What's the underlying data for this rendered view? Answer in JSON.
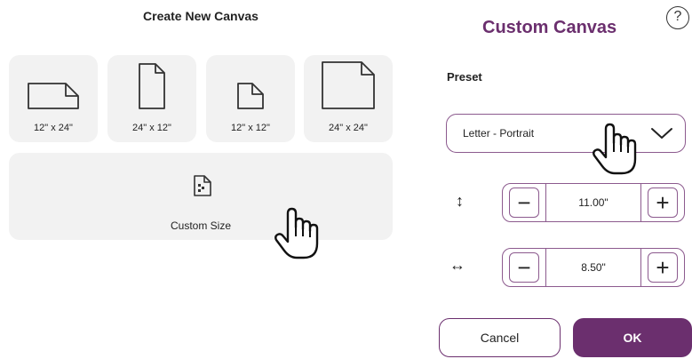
{
  "left_panel": {
    "title": "Create New Canvas",
    "tiles": [
      {
        "label": "12\" x 24\"",
        "icon": "landscape-page-icon"
      },
      {
        "label": "24\" x 12\"",
        "icon": "portrait-page-icon"
      },
      {
        "label": "12\" x 12\"",
        "icon": "small-square-page-icon"
      },
      {
        "label": "24\" x 24\"",
        "icon": "large-square-page-icon"
      }
    ],
    "custom_tile": {
      "label": "Custom Size",
      "icon": "custom-size-icon"
    }
  },
  "right_panel": {
    "title": "Custom Canvas",
    "help_glyph": "?",
    "preset_label": "Preset",
    "preset_value": "Letter - Portrait",
    "height": {
      "value": "11.00\"",
      "minus": "−",
      "plus": "+",
      "icon": "↕"
    },
    "width": {
      "value": "8.50\"",
      "minus": "−",
      "plus": "+",
      "icon": "↔"
    },
    "cancel_label": "Cancel",
    "ok_label": "OK"
  },
  "colors": {
    "accent": "#6b2f6e",
    "border": "#8c5a8e",
    "tile_bg": "#f2f2f2"
  }
}
